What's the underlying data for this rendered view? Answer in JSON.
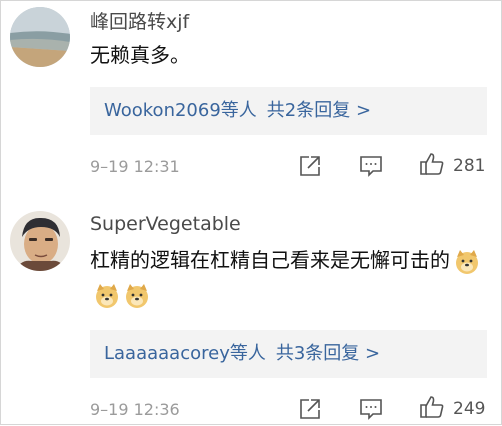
{
  "comments": [
    {
      "username": "峰回路转xjf",
      "content": "无赖真多。",
      "replies": {
        "user": "Wookon2069",
        "mid": "等人",
        "count_text": "共2条回复 >"
      },
      "date": "9–19 12:31",
      "likes": "281",
      "icons": {
        "share": "share-icon",
        "comment": "comment-icon",
        "like": "thumbs-up-icon"
      }
    },
    {
      "username": "SuperVegetable",
      "content": "杠精的逻辑在杠精自己看来是无懈可击的",
      "emoji": "doge-emoji",
      "replies": {
        "user": "Laaaaaacorey",
        "mid": "等人",
        "count_text": "共3条回复 >"
      },
      "date": "9–19 12:36",
      "likes": "249",
      "icons": {
        "share": "share-icon",
        "comment": "comment-icon",
        "like": "thumbs-up-icon"
      }
    }
  ]
}
